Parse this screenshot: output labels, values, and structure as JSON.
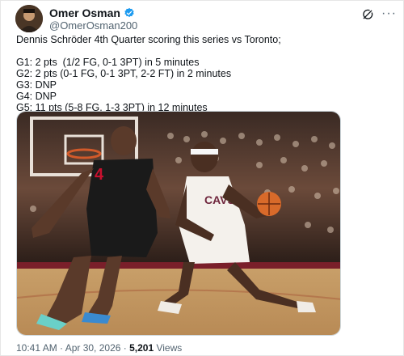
{
  "author": {
    "display_name": "Omer Osman",
    "handle": "@OmerOsman200"
  },
  "tweet": {
    "lines": [
      "Dennis Schröder 4th Quarter scoring this series vs Toronto;",
      "G1: 2 pts  (1/2 FG, 0-1 3PT) in 5 minutes",
      "G2: 2 pts (0-1 FG, 0-1 3PT, 2-2 FT) in 2 minutes",
      "G3: DNP",
      "G4: DNP",
      "G5: 11 pts (5-8 FG, 1-3 3PT) in 12 minutes"
    ],
    "media_description_icon": "basketball-photo",
    "timestamp": "10:41 AM · Apr 30, 2026 · ",
    "views_count": "5,201",
    "views_label": " Views"
  },
  "photo": {
    "left_jersey_number": "4",
    "right_jersey_text": "CAVS"
  },
  "icons": {
    "verified": "verified-badge-icon",
    "grok": "grok-icon",
    "more": "more-icon"
  },
  "colors": {
    "verified_blue": "#1d9bf0",
    "muted_text": "#536471",
    "raptors_black": "#1a1a1a",
    "cavs_white": "#f4f1ec",
    "court": "#c9a06a"
  }
}
